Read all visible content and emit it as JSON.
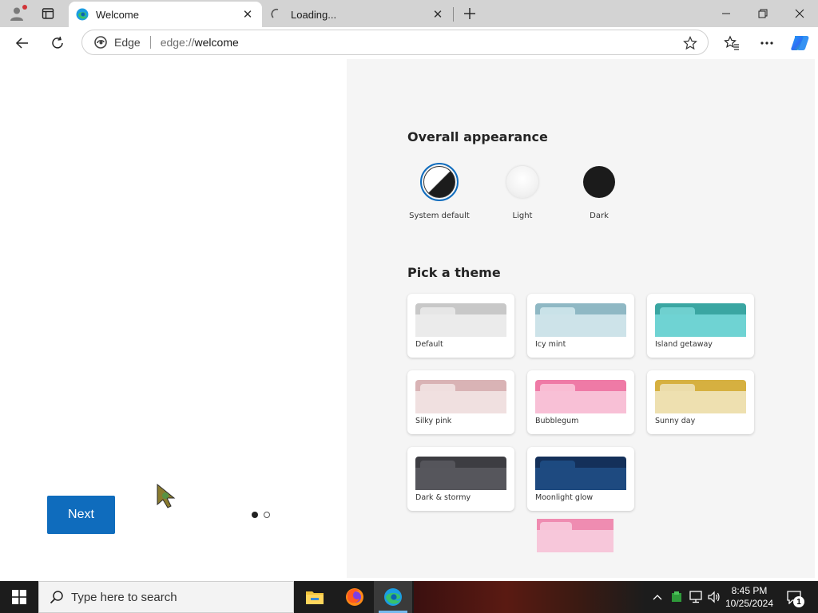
{
  "browser": {
    "tabs": [
      {
        "title": "Welcome",
        "active": true
      },
      {
        "title": "Loading...",
        "active": false
      }
    ],
    "address": {
      "site_label": "Edge",
      "url_scheme": "edge://",
      "url_path": "welcome"
    }
  },
  "welcome": {
    "next_label": "Next",
    "pager": {
      "current": 1,
      "total": 2
    },
    "appearance_title": "Overall appearance",
    "appearance_options": [
      {
        "label": "System default",
        "selected": true
      },
      {
        "label": "Light",
        "selected": false
      },
      {
        "label": "Dark",
        "selected": false
      }
    ],
    "theme_title": "Pick a theme",
    "themes": [
      {
        "label": "Default",
        "bar": "#c8c8c8",
        "tab": "#e6e6e6",
        "body": "#ebebeb"
      },
      {
        "label": "Icy mint",
        "bar": "#8fb8c4",
        "tab": "#c9e2e8",
        "body": "#cde3e9"
      },
      {
        "label": "Island getaway",
        "bar": "#3aa6a2",
        "tab": "#6fd0cf",
        "body": "#6fd3d3"
      },
      {
        "label": "Silky pink",
        "bar": "#d9b3b5",
        "tab": "#efdede",
        "body": "#f0e0e0"
      },
      {
        "label": "Bubblegum",
        "bar": "#ef7aa6",
        "tab": "#f9bcd3",
        "body": "#f8c0d6"
      },
      {
        "label": "Sunny day",
        "bar": "#d6b040",
        "tab": "#ebdcaa",
        "body": "#eee0b0"
      },
      {
        "label": "Dark & stormy",
        "bar": "#3d3d42",
        "tab": "#55555b",
        "body": "#56565c"
      },
      {
        "label": "Moonlight glow",
        "bar": "#14305a",
        "tab": "#1d4a80",
        "body": "#1e4a80"
      }
    ]
  },
  "taskbar": {
    "search_placeholder": "Type here to search",
    "time": "8:45 PM",
    "date": "10/25/2024",
    "notification_count": "1"
  }
}
